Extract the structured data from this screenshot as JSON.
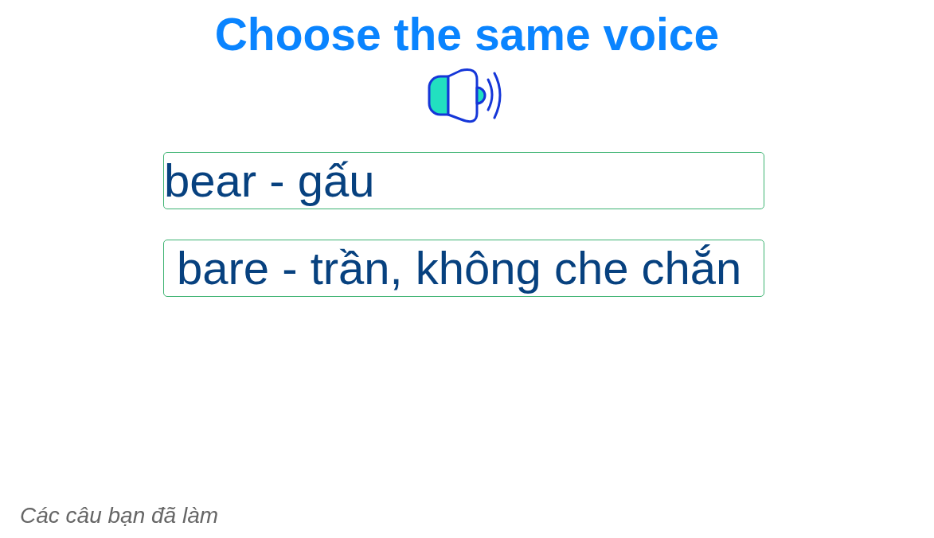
{
  "title": "Choose the same voice",
  "options": [
    {
      "label": "bear - gấu"
    },
    {
      "label": "bare - trần, không che chắn"
    }
  ],
  "footer": {
    "link": "Các câu bạn đã làm"
  }
}
